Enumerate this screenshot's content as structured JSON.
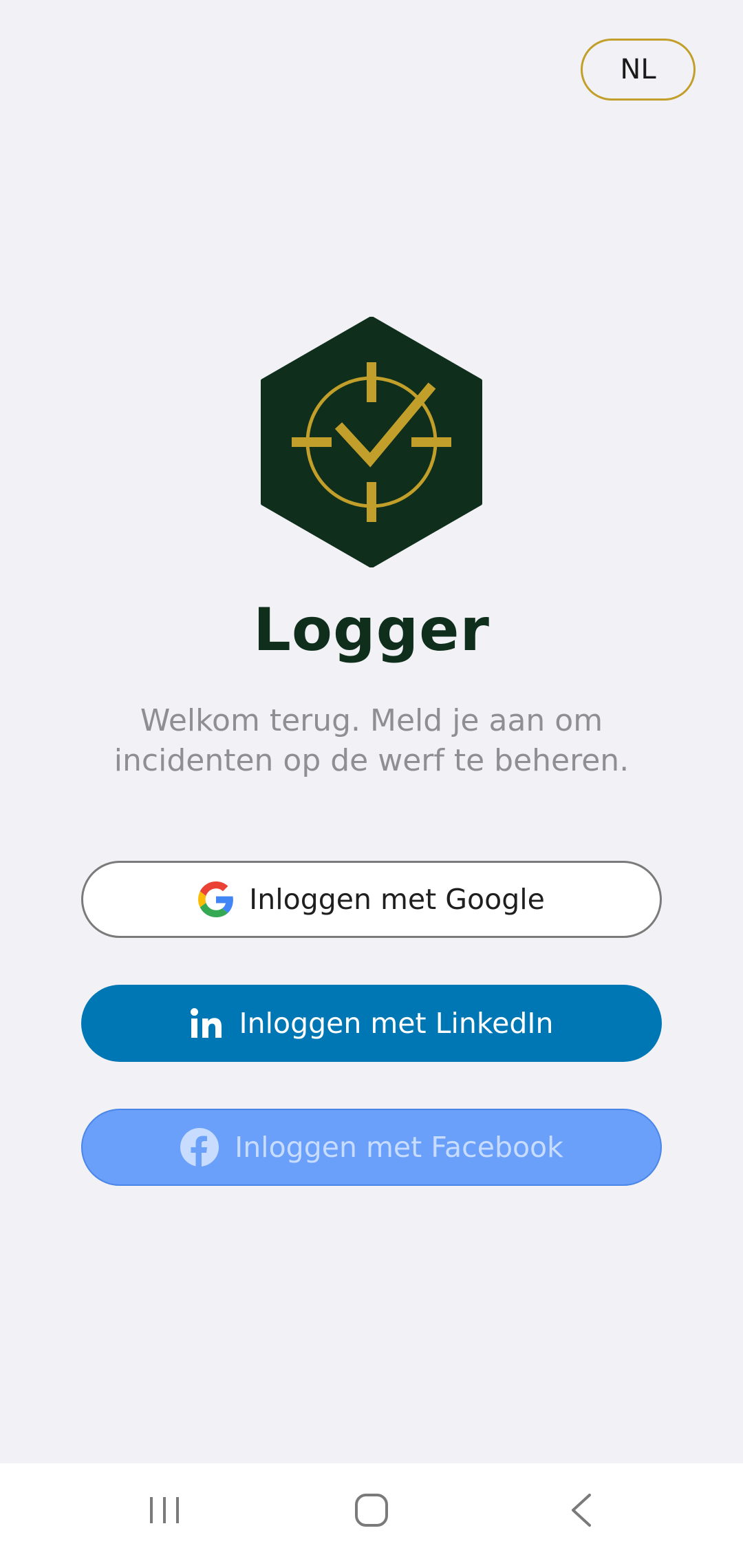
{
  "language": {
    "label": "NL"
  },
  "app": {
    "title": "Logger",
    "subtitle": "Welkom terug. Meld je aan om incidenten op de werf te beheren."
  },
  "login": {
    "google_label": "Inloggen met Google",
    "linkedin_label": "Inloggen met LinkedIn",
    "facebook_label": "Inloggen met Facebook"
  },
  "icons": {
    "logo": "hexagon-crosshair-check-logo",
    "google": "google-g-icon",
    "linkedin": "linkedin-in-icon",
    "facebook": "facebook-f-icon",
    "nav_recents": "recents-icon",
    "nav_home": "home-icon",
    "nav_back": "back-icon"
  },
  "colors": {
    "background": "#f2f2f6",
    "brand_dark": "#0f2e1b",
    "brand_gold": "#c29f2a",
    "linkedin": "#0077b5",
    "facebook": "#6aa0fa"
  }
}
